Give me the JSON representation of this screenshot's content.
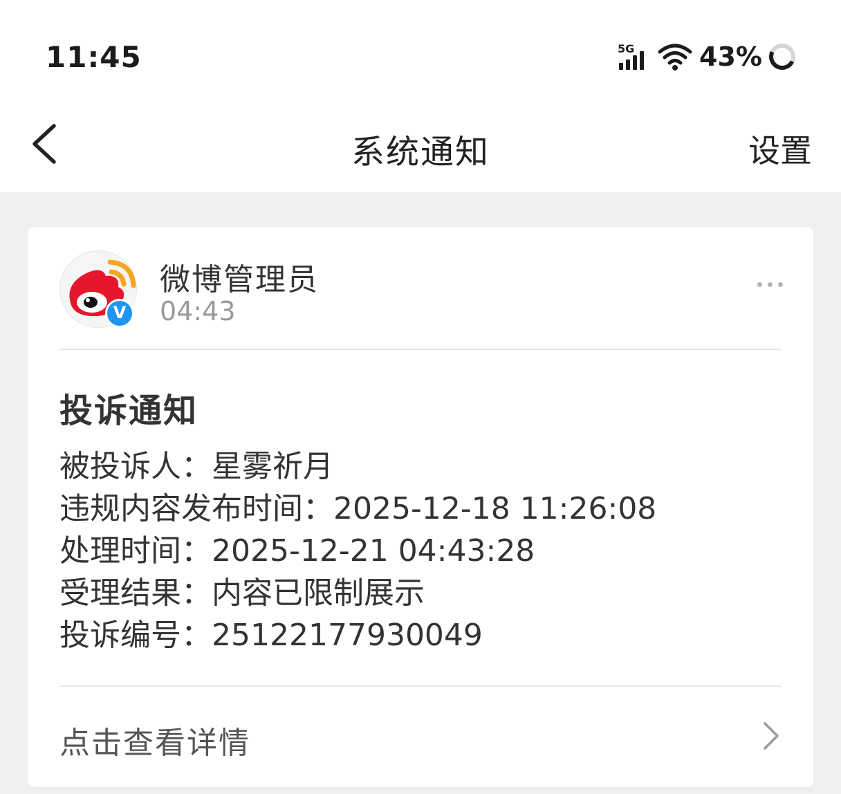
{
  "status_bar": {
    "time": "11:45",
    "network": "5G",
    "battery": "43%"
  },
  "icons": {
    "back": "chevron-left-icon",
    "signal": "cellular-signal-icon",
    "wifi": "wifi-icon",
    "battery": "battery-ring-icon",
    "more": "more-dots-icon",
    "detail": "chevron-right-icon",
    "verified": "verified-v-icon"
  },
  "nav": {
    "title": "系统通知",
    "settings_label": "设置"
  },
  "message": {
    "sender": "微博管理员",
    "time": "04:43",
    "verified_mark": "V",
    "title": "投诉通知",
    "lines": [
      "被投诉人：星雾祈月",
      "违规内容发布时间：2025-12-18 11:26:08",
      "处理时间：2025-12-21 04:43:28",
      "受理结果：内容已限制展示",
      "投诉编号：25122177930049"
    ],
    "detail_label": "点击查看详情"
  },
  "colors": {
    "page_background": "#efefef",
    "card_background": "#ffffff",
    "primary_text": "#333333",
    "secondary_text": "#9a9a9a",
    "verified_blue": "#1f95f0",
    "weibo_red": "#e6162d",
    "weibo_orange": "#f5a623"
  }
}
